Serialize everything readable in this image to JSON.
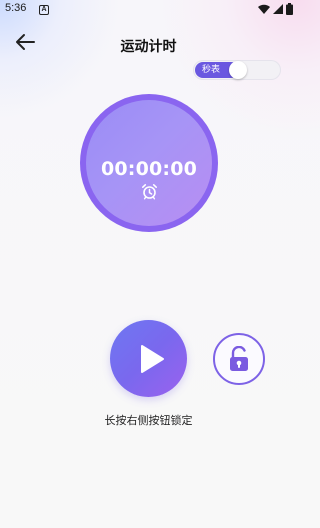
{
  "status_bar": {
    "time": "5:36",
    "notification_badge": "A",
    "icons": [
      "wifi-icon",
      "signal-icon",
      "battery-icon"
    ]
  },
  "header": {
    "title": "运动计时",
    "back_icon": "arrow-left-icon"
  },
  "stopwatch_toggle": {
    "label": "秒表",
    "enabled": false
  },
  "timer": {
    "display": "00:00:00",
    "icon": "alarm-clock-icon"
  },
  "controls": {
    "play_icon": "play-icon",
    "lock_icon": "unlock-icon",
    "hint": "长按右侧按钮锁定"
  },
  "colors": {
    "accent": "#7b62ea",
    "ring": "#8a65f0",
    "text": "#111111"
  }
}
